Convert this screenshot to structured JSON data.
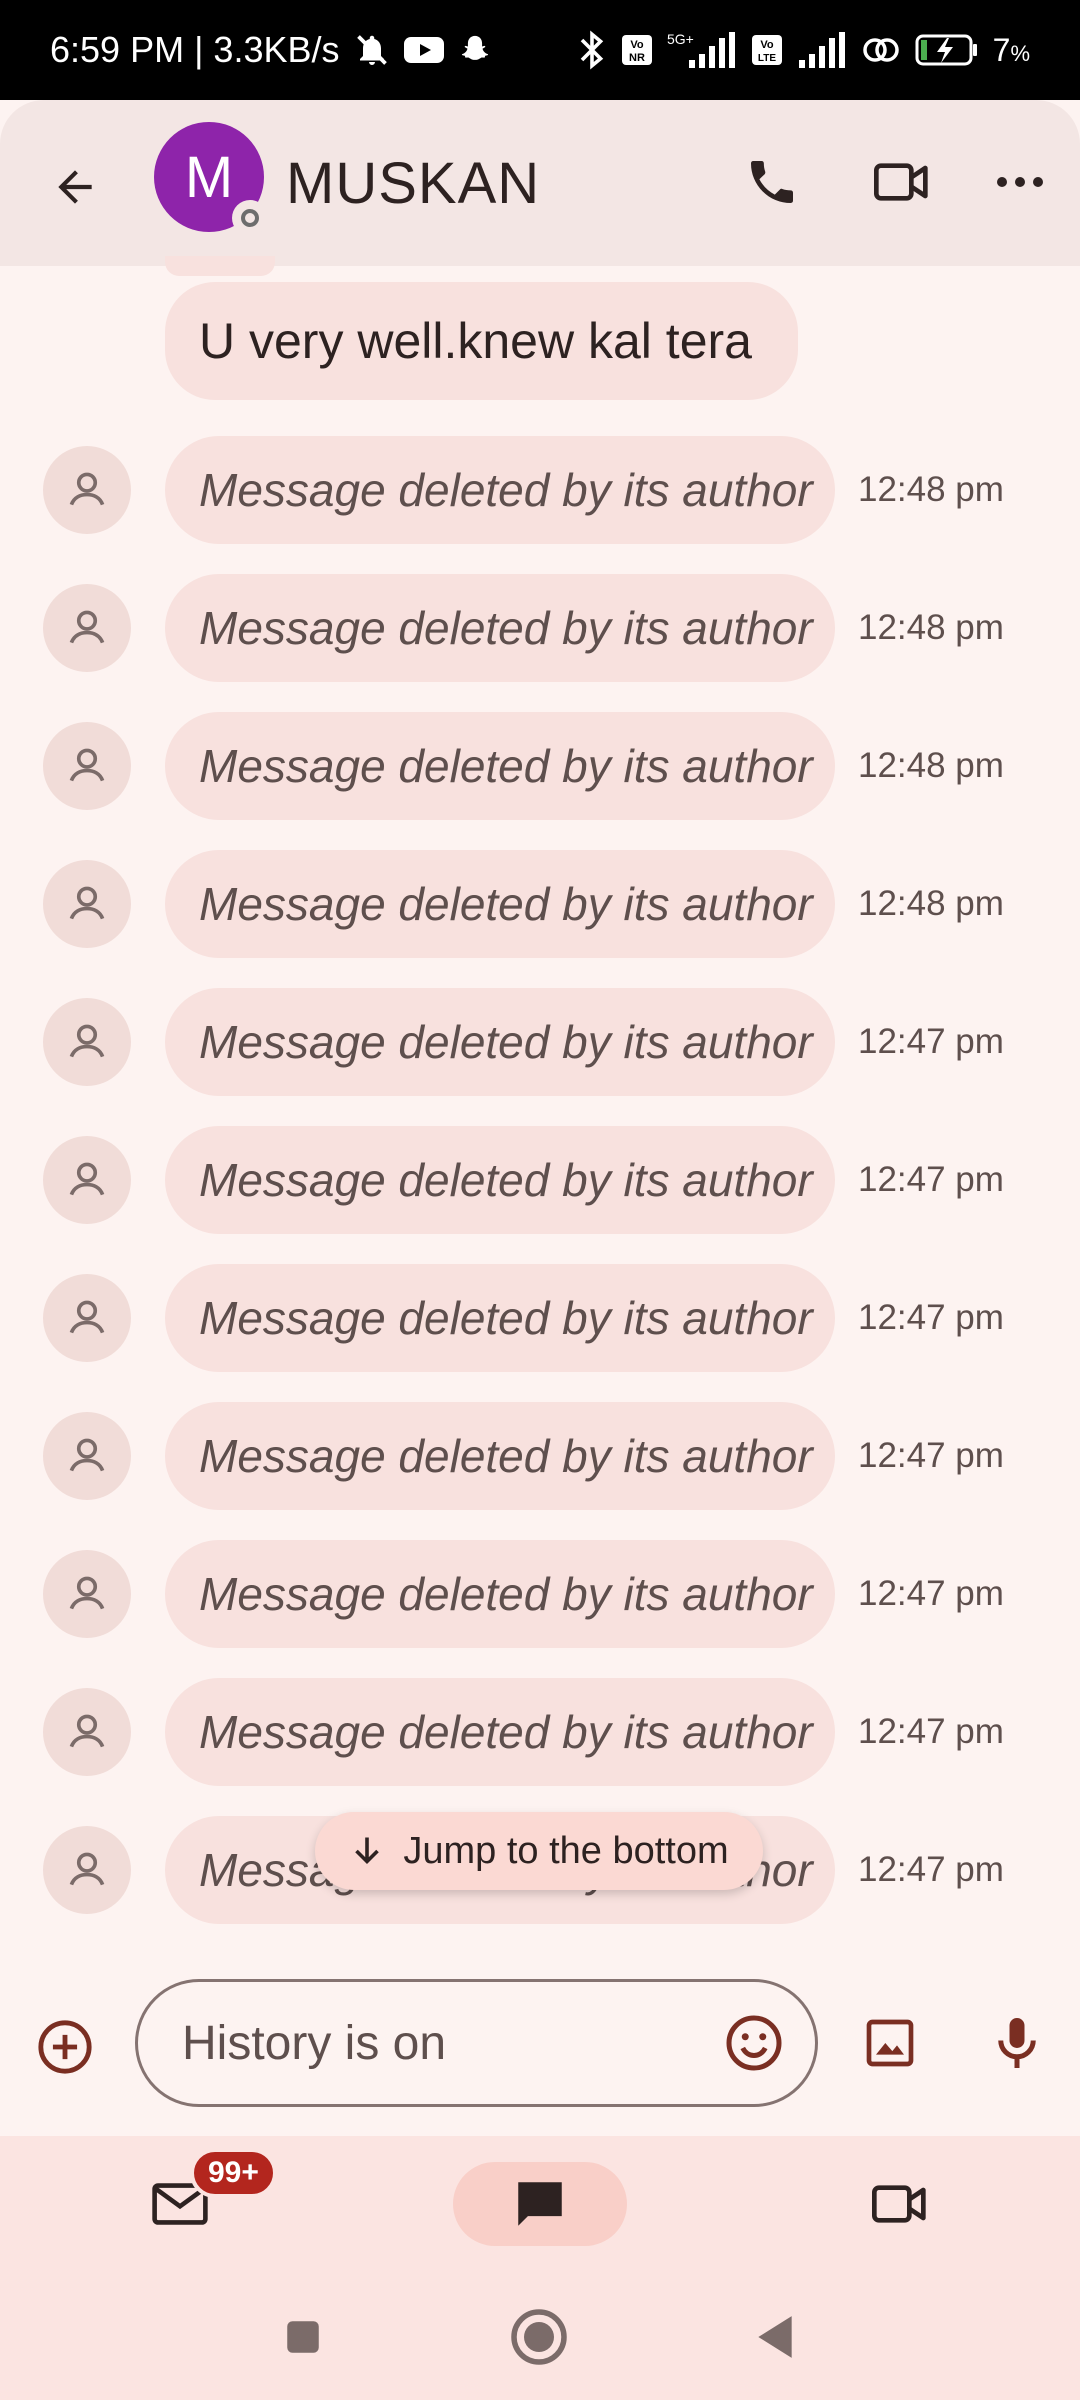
{
  "status_bar": {
    "time_speed": "6:59 PM | 3.3KB/s",
    "network_5g": "5G+",
    "volte_1": "Vo NR",
    "volte_2": "Vo LTE",
    "battery": "7"
  },
  "header": {
    "avatar_letter": "M",
    "contact_name": "MUSKAN"
  },
  "messages": {
    "top_message": "U very well.knew kal tera",
    "deleted": [
      {
        "text": "Message deleted by its author",
        "time": "12:48 pm"
      },
      {
        "text": "Message deleted by its author",
        "time": "12:48 pm"
      },
      {
        "text": "Message deleted by its author",
        "time": "12:48 pm"
      },
      {
        "text": "Message deleted by its author",
        "time": "12:48 pm"
      },
      {
        "text": "Message deleted by its author",
        "time": "12:47 pm"
      },
      {
        "text": "Message deleted by its author",
        "time": "12:47 pm"
      },
      {
        "text": "Message deleted by its author",
        "time": "12:47 pm"
      },
      {
        "text": "Message deleted by its author",
        "time": "12:47 pm"
      },
      {
        "text": "Message deleted by its author",
        "time": "12:47 pm"
      },
      {
        "text": "Message deleted by its author",
        "time": "12:47 pm"
      },
      {
        "text": "Message deleted by its author",
        "time": "12:47 pm"
      }
    ]
  },
  "jump_button": {
    "label": "Jump to the bottom"
  },
  "composer": {
    "placeholder": "History is on"
  },
  "bottom_nav": {
    "mail_badge": "99+"
  },
  "colors": {
    "accent": "#8e24aa",
    "icon": "#7a2e22",
    "badge": "#b3261e"
  }
}
